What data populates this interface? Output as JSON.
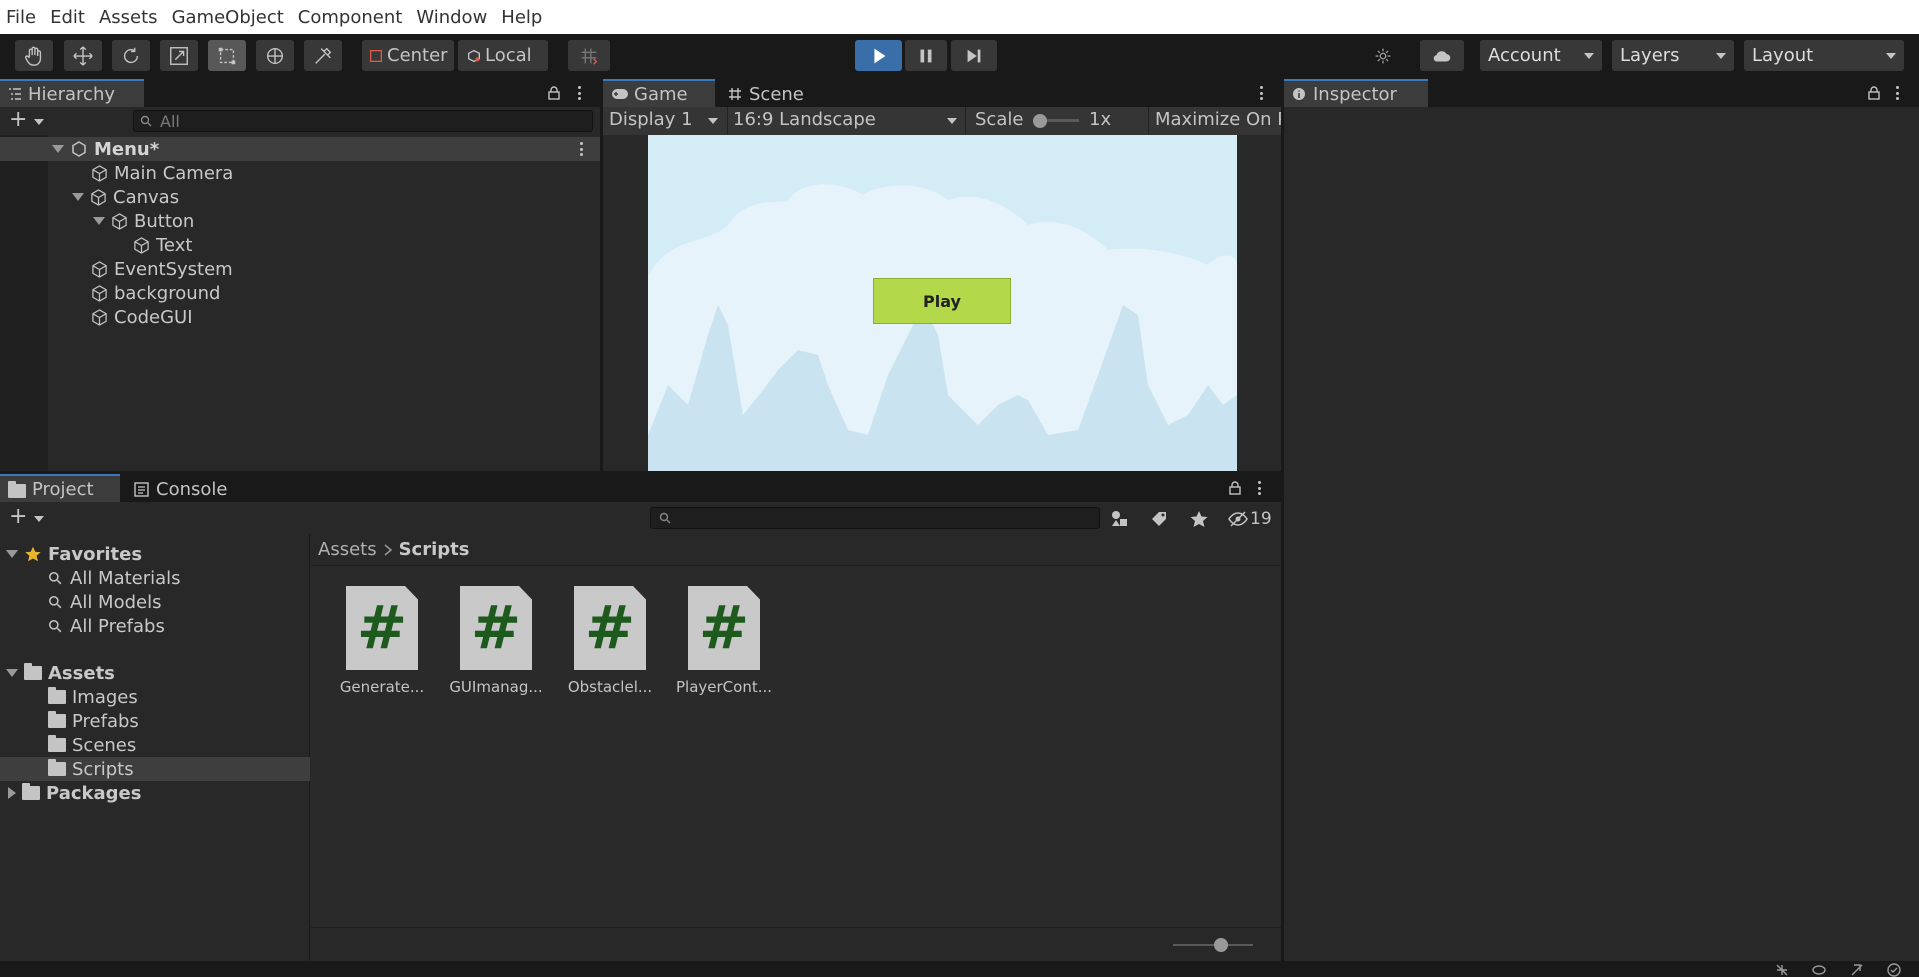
{
  "menubar": [
    "File",
    "Edit",
    "Assets",
    "GameObject",
    "Component",
    "Window",
    "Help"
  ],
  "toolbar": {
    "pivot": "Center",
    "space": "Local",
    "account": "Account",
    "layers": "Layers",
    "layout": "Layout"
  },
  "hierarchy": {
    "tab": "Hierarchy",
    "search_placeholder": "All",
    "scene": "Menu*",
    "items": [
      "Main Camera",
      "Canvas",
      "Button",
      "Text",
      "EventSystem",
      "background",
      "CodeGUI"
    ]
  },
  "game": {
    "tab_game": "Game",
    "tab_scene": "Scene",
    "display": "Display 1",
    "aspect": "16:9 Landscape",
    "scale_label": "Scale",
    "scale_value": "1x",
    "maximize": "Maximize On P",
    "play_button": "Play",
    "colors": {
      "sky": "#d4ecf6",
      "button": "#b3d84a"
    }
  },
  "inspector": {
    "tab": "Inspector"
  },
  "project": {
    "tab_project": "Project",
    "tab_console": "Console",
    "hidden_count": "19",
    "favorites": {
      "label": "Favorites",
      "items": [
        "All Materials",
        "All Models",
        "All Prefabs"
      ]
    },
    "assets": {
      "label": "Assets",
      "items": [
        "Images",
        "Prefabs",
        "Scenes",
        "Scripts"
      ]
    },
    "packages": "Packages",
    "breadcrumb": {
      "root": "Assets",
      "current": "Scripts"
    },
    "files": [
      "Generate...",
      "GUImanag...",
      "Obstaclel...",
      "PlayerCont..."
    ]
  }
}
